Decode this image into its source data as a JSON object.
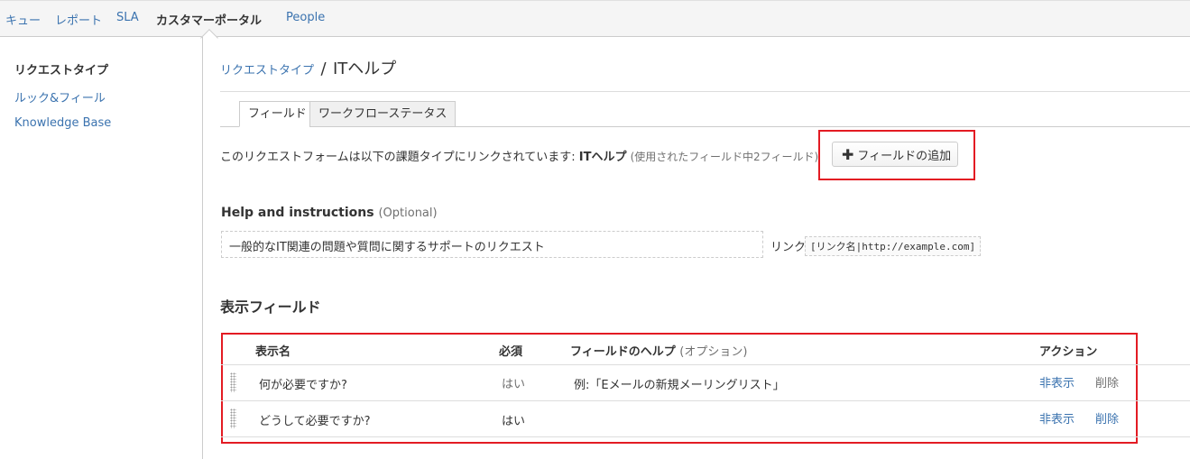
{
  "topnav": {
    "items": [
      {
        "label": "キュー"
      },
      {
        "label": "レポート"
      },
      {
        "label": "SLA"
      },
      {
        "label": "カスタマーポータル"
      },
      {
        "label": "People"
      }
    ],
    "active": "カスタマーポータル"
  },
  "sidebar": {
    "items": [
      {
        "label": "リクエストタイプ"
      },
      {
        "label": "ルック&フィール"
      },
      {
        "label": "Knowledge Base"
      }
    ]
  },
  "breadcrumb": {
    "parent": "リクエストタイプ",
    "separator": "/",
    "title": "ITヘルプ"
  },
  "tabs": [
    {
      "label": "フィールド"
    },
    {
      "label": "ワークフローステータス"
    }
  ],
  "form_info": {
    "text": "このリクエストフォームは以下の課題タイプにリンクされています:",
    "issue_type": "ITヘルプ",
    "usage": "(使用されたフィールド中2フィールド)"
  },
  "add_field_button": {
    "icon": "plus-icon",
    "label": "フィールドの追加"
  },
  "help": {
    "label": "Help and instructions",
    "optional": "(Optional)",
    "value": "一般的なIT関連の問題や質問に関するサポートのリクエスト",
    "link_label": "リンク",
    "link_syntax": "[リンク名|http://example.com]"
  },
  "visible_fields": {
    "title": "表示フィールド",
    "headers": {
      "name": "表示名",
      "required": "必須",
      "help": "フィールドのヘルプ",
      "help_optional": "(オプション)",
      "actions": "アクション"
    },
    "rows": [
      {
        "name": "何が必要ですか?",
        "required": "はい",
        "help": "例:「Eメールの新規メーリングリスト」",
        "hide": "非表示",
        "delete": "削除"
      },
      {
        "name": "どうして必要ですか?",
        "required": "はい",
        "help": "",
        "hide": "非表示",
        "delete": "削除"
      }
    ]
  },
  "colors": {
    "link": "#3b73af",
    "highlight": "#e31b23"
  }
}
